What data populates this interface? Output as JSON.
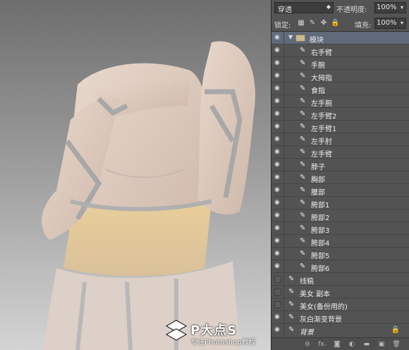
{
  "options": {
    "blend_mode": "穿透",
    "opacity_label": "不透明度:",
    "opacity_value": "100%",
    "lock_label": "锁定:",
    "fill_label": "填充:",
    "fill_value": "100%"
  },
  "layers": [
    {
      "name": "模块",
      "type": "group",
      "visible": true,
      "selected": true
    },
    {
      "name": "右手臂",
      "type": "layer",
      "visible": true,
      "indent": true
    },
    {
      "name": "手腕",
      "type": "layer",
      "visible": true,
      "indent": true
    },
    {
      "name": "大拇指",
      "type": "layer",
      "visible": true,
      "indent": true
    },
    {
      "name": "食指",
      "type": "layer",
      "visible": true,
      "indent": true
    },
    {
      "name": "左手腕",
      "type": "layer",
      "visible": true,
      "indent": true
    },
    {
      "name": "左手臂2",
      "type": "layer",
      "visible": true,
      "indent": true
    },
    {
      "name": "左手臂1",
      "type": "layer",
      "visible": true,
      "indent": true
    },
    {
      "name": "左手肘",
      "type": "layer",
      "visible": true,
      "indent": true
    },
    {
      "name": "左手臂",
      "type": "layer",
      "visible": true,
      "indent": true
    },
    {
      "name": "脖子",
      "type": "layer",
      "visible": true,
      "indent": true
    },
    {
      "name": "胸部",
      "type": "layer",
      "visible": true,
      "indent": true
    },
    {
      "name": "腰部",
      "type": "layer",
      "visible": true,
      "indent": true
    },
    {
      "name": "胯部1",
      "type": "layer",
      "visible": true,
      "indent": true
    },
    {
      "name": "胯部2",
      "type": "layer",
      "visible": true,
      "indent": true
    },
    {
      "name": "胯部3",
      "type": "layer",
      "visible": true,
      "indent": true
    },
    {
      "name": "胯部4",
      "type": "layer",
      "visible": true,
      "indent": true
    },
    {
      "name": "胯部5",
      "type": "layer",
      "visible": true,
      "indent": true
    },
    {
      "name": "胯部6",
      "type": "layer",
      "visible": true,
      "indent": true
    },
    {
      "name": "线稿",
      "type": "layer",
      "visible": false,
      "indent": false
    },
    {
      "name": "美女 副本",
      "type": "layer",
      "visible": false,
      "indent": false
    },
    {
      "name": "美女(备份用的)",
      "type": "layer",
      "visible": false,
      "indent": false
    },
    {
      "name": "灰白渐变背景",
      "type": "layer",
      "visible": true,
      "indent": false
    },
    {
      "name": "背景",
      "type": "background",
      "visible": true,
      "indent": false
    }
  ],
  "footer_icons": [
    "link-icon",
    "fx-icon",
    "mask-icon",
    "adjustment-icon",
    "folder-icon",
    "new-layer-icon",
    "trash-icon"
  ],
  "footer_glyphs": [
    "⊖",
    "fx.",
    "◙",
    "◐",
    "▬",
    "▣",
    "🗑"
  ],
  "watermark": {
    "title": "P大点S",
    "subtitle": "专注Photoshop教程"
  },
  "colors": {
    "panel_bg": "#535353",
    "selected_row": "#606a7a",
    "canvas_top": "#6e6e6e",
    "canvas_bottom": "#d4d4d4"
  }
}
